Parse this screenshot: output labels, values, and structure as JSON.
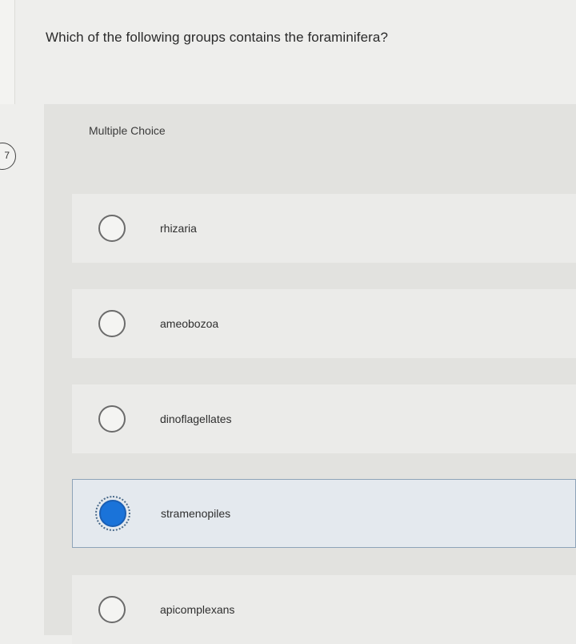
{
  "question": {
    "number": "7",
    "text": "Which of the following groups contains the foraminifera?"
  },
  "answer_type": "Multiple Choice",
  "options": [
    {
      "label": "rhizaria",
      "selected": false
    },
    {
      "label": "ameobozoa",
      "selected": false
    },
    {
      "label": "dinoflagellates",
      "selected": false
    },
    {
      "label": "stramenopiles",
      "selected": true
    },
    {
      "label": "apicomplexans",
      "selected": false
    }
  ],
  "colors": {
    "selected_radio": "#1a73d9",
    "selected_border": "#8ea3b8"
  }
}
